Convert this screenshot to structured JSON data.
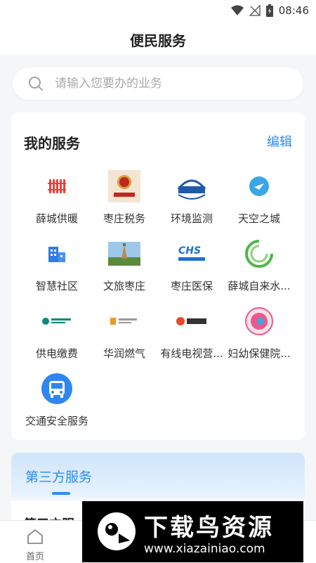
{
  "status_bar": {
    "time": "08:46"
  },
  "header": {
    "title": "便民服务"
  },
  "search": {
    "placeholder": "请输入您要办的业务"
  },
  "my_services": {
    "title": "我的服务",
    "edit_label": "编辑",
    "items": [
      {
        "label": "薛城供暖",
        "icon": "radiator-icon"
      },
      {
        "label": "枣庄税务",
        "icon": "tax-emblem-icon"
      },
      {
        "label": "环境监测",
        "icon": "cnemc-logo-icon"
      },
      {
        "label": "天空之城",
        "icon": "sky-city-icon"
      },
      {
        "label": "智慧社区",
        "icon": "building-icon"
      },
      {
        "label": "文旅枣庄",
        "icon": "pagoda-photo-icon"
      },
      {
        "label": "枣庄医保",
        "icon": "chs-logo-icon"
      },
      {
        "label": "薛城自来水...",
        "icon": "water-logo-icon"
      },
      {
        "label": "供电缴费",
        "icon": "state-grid-logo-icon"
      },
      {
        "label": "华润燃气",
        "icon": "cr-gas-logo-icon"
      },
      {
        "label": "有线电视营...",
        "icon": "cable-tv-logo-icon"
      },
      {
        "label": "妇幼保健院...",
        "icon": "maternal-hospital-logo-icon"
      },
      {
        "label": "交通安全服务",
        "icon": "bus-icon"
      }
    ]
  },
  "third_party": {
    "title": "第三方服务",
    "body_title": "第三方服"
  },
  "bottom_nav": {
    "home_label": "首页"
  },
  "watermark": {
    "main": "下载鸟资源",
    "url": "www.xiazainiao.com"
  },
  "colors": {
    "accent": "#2e8cf0",
    "background": "#f4f6f8"
  }
}
